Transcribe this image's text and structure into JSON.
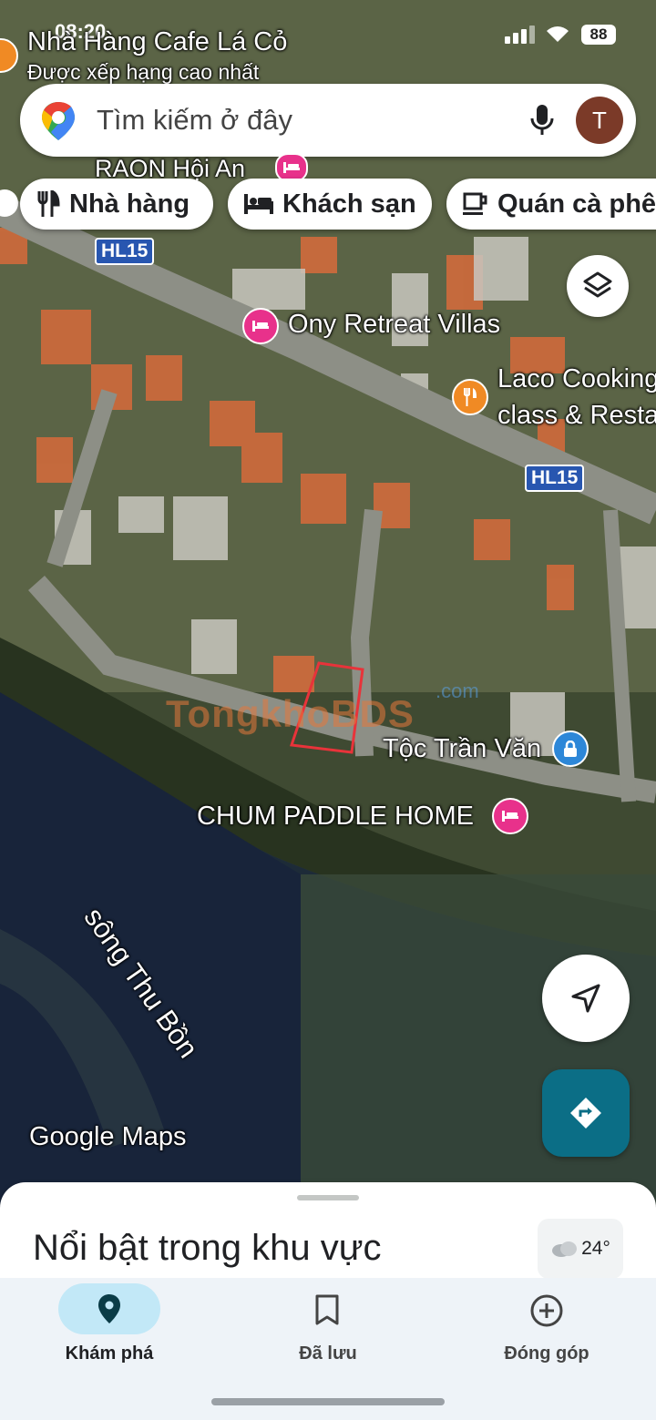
{
  "status": {
    "time": "08:20",
    "battery": "88"
  },
  "search": {
    "placeholder": "Tìm kiếm ở đây",
    "avatar_letter": "T"
  },
  "top_place": {
    "name": "Nhà Hàng Cafe Lá Cỏ",
    "subtitle": "Được xếp hạng cao nhất"
  },
  "chips": [
    {
      "label": "Nhà hàng",
      "icon": "fork-knife-icon"
    },
    {
      "label": "Khách sạn",
      "icon": "bed-icon"
    },
    {
      "label": "Quán cà phê",
      "icon": "coffee-cup-icon"
    }
  ],
  "map_labels": {
    "raon": "RAON Hội An",
    "ony": "Ony Retreat Villas",
    "laco_1": "Laco Cooking",
    "laco_2": "class & Resta",
    "toc": "Tộc Trần Văn",
    "chum": "CHUM PADDLE HOME",
    "river": "sông Thu Bồn",
    "road_1": "HL15",
    "road_2": "HL15",
    "watermark": "TongkhoBDS",
    "watermark_suffix": ".com",
    "google_maps": "Google Maps"
  },
  "sheet": {
    "title": "Nổi bật trong khu vực",
    "weather": "24°"
  },
  "nav": [
    {
      "label": "Khám phá",
      "icon": "location-pin-icon",
      "active": true
    },
    {
      "label": "Đã lưu",
      "icon": "bookmark-icon",
      "active": false
    },
    {
      "label": "Đóng góp",
      "icon": "add-circle-icon",
      "active": false
    }
  ],
  "colors": {
    "directions_fab": "#0b6e86",
    "active_nav_pill": "#c2e8f7",
    "lodging_pin": "#e8318b",
    "restaurant_pin": "#f08a24",
    "road_badge": "#2856b0"
  }
}
